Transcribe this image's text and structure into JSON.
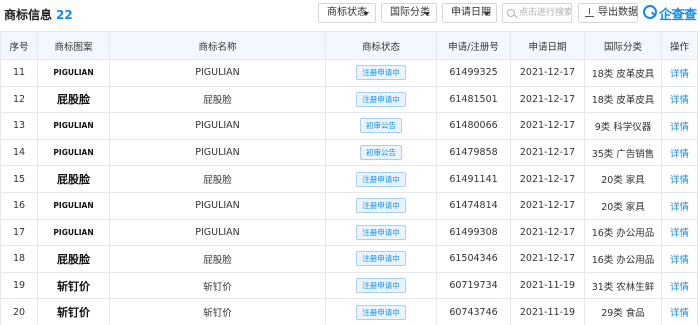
{
  "header": {
    "title": "商标信息",
    "count": "22",
    "filters": {
      "status": "商标状态",
      "class": "国际分类",
      "date": "申请日期"
    },
    "search_placeholder": "点击进行搜索",
    "export_label": "导出数据",
    "logo_text": "企查查"
  },
  "table": {
    "columns": [
      "序号",
      "商标图案",
      "商标名称",
      "商标状态",
      "申请/注册号",
      "申请日期",
      "国际分类",
      "操作"
    ],
    "rows": [
      {
        "no": "11",
        "pattern": "PIGULIAN",
        "name": "PIGULIAN",
        "status": "注册申请中",
        "reg_no": "61499325",
        "date": "2021-12-17",
        "class": "18类 皮革皮具",
        "action": "详情"
      },
      {
        "no": "12",
        "pattern": "屁股脸",
        "name": "屁股脸",
        "status": "注册申请中",
        "reg_no": "61481501",
        "date": "2021-12-17",
        "class": "18类 皮革皮具",
        "action": "详情"
      },
      {
        "no": "13",
        "pattern": "PIGULIAN",
        "name": "PIGULIAN",
        "status": "初审公告",
        "reg_no": "61480066",
        "date": "2021-12-17",
        "class": "9类 科学仪器",
        "action": "详情"
      },
      {
        "no": "14",
        "pattern": "PIGULIAN",
        "name": "PIGULIAN",
        "status": "初审公告",
        "reg_no": "61479858",
        "date": "2021-12-17",
        "class": "35类 广告销售",
        "action": "详情"
      },
      {
        "no": "15",
        "pattern": "屁股脸",
        "name": "屁股脸",
        "status": "注册申请中",
        "reg_no": "61491141",
        "date": "2021-12-17",
        "class": "20类 家具",
        "action": "详情"
      },
      {
        "no": "16",
        "pattern": "PIGULIAN",
        "name": "PIGULIAN",
        "status": "注册申请中",
        "reg_no": "61474814",
        "date": "2021-12-17",
        "class": "20类 家具",
        "action": "详情"
      },
      {
        "no": "17",
        "pattern": "PIGULIAN",
        "name": "PIGULIAN",
        "status": "注册申请中",
        "reg_no": "61499308",
        "date": "2021-12-17",
        "class": "16类 办公用品",
        "action": "详情"
      },
      {
        "no": "18",
        "pattern": "屁股脸",
        "name": "屁股脸",
        "status": "注册申请中",
        "reg_no": "61504346",
        "date": "2021-12-17",
        "class": "16类 办公用品",
        "action": "详情"
      },
      {
        "no": "19",
        "pattern": "斩钉价",
        "name": "斩钉价",
        "status": "注册申请中",
        "reg_no": "60719734",
        "date": "2021-11-19",
        "class": "31类 农林生鲜",
        "action": "详情"
      },
      {
        "no": "20",
        "pattern": "斩钉价",
        "name": "斩钉价",
        "status": "注册申请中",
        "reg_no": "60743746",
        "date": "2021-11-19",
        "class": "29类 食品",
        "action": "详情"
      }
    ]
  },
  "colors": {
    "accent": "#128bed",
    "header_bg": "#f2f8fe",
    "border": "#e4e9ef"
  }
}
